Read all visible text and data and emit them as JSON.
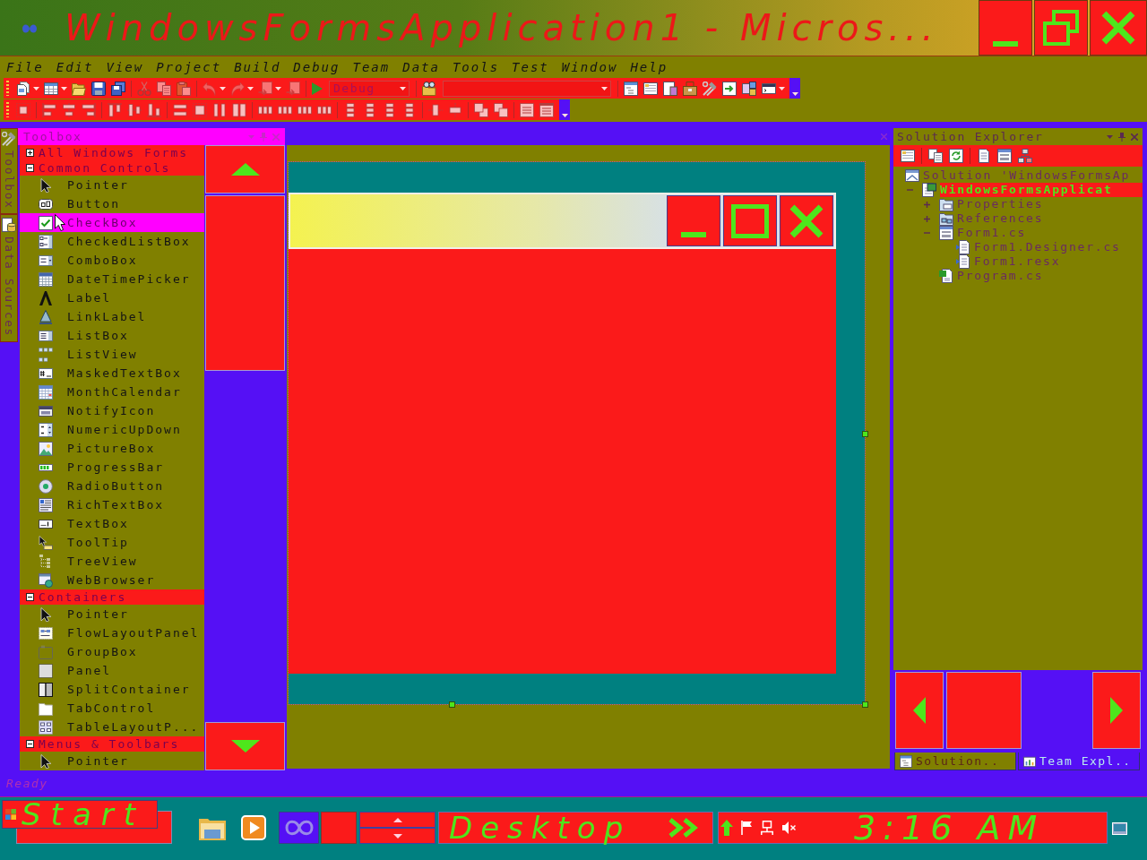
{
  "window": {
    "title": "WindowsFormsApplication1 - Micros..."
  },
  "menu": [
    "File",
    "Edit",
    "View",
    "Project",
    "Build",
    "Debug",
    "Team",
    "Data",
    "Tools",
    "Test",
    "Window",
    "Help"
  ],
  "standard_toolbar": {
    "configuration": "Debug"
  },
  "side_tabs": [
    {
      "label": "Toolbox",
      "kind": "toolbox"
    },
    {
      "label": "Data Sources",
      "kind": "data"
    }
  ],
  "toolbox": {
    "title": "Toolbox",
    "groups": [
      {
        "label": "All Windows Forms",
        "expanded": false
      },
      {
        "label": "Common Controls",
        "expanded": true,
        "items": [
          {
            "label": "Pointer",
            "kind": "pointer",
            "selected": false
          },
          {
            "label": "Button",
            "kind": "button",
            "selected": false
          },
          {
            "label": "CheckBox",
            "kind": "checkbox",
            "selected": true
          },
          {
            "label": "CheckedListBox",
            "kind": "checkedlist",
            "selected": false
          },
          {
            "label": "ComboBox",
            "kind": "combo",
            "selected": false
          },
          {
            "label": "DateTimePicker",
            "kind": "datetime",
            "selected": false
          },
          {
            "label": "Label",
            "kind": "label",
            "selected": false
          },
          {
            "label": "LinkLabel",
            "kind": "linklabel",
            "selected": false
          },
          {
            "label": "ListBox",
            "kind": "listbox",
            "selected": false
          },
          {
            "label": "ListView",
            "kind": "listview",
            "selected": false
          },
          {
            "label": "MaskedTextBox",
            "kind": "masked",
            "selected": false
          },
          {
            "label": "MonthCalendar",
            "kind": "monthcal",
            "selected": false
          },
          {
            "label": "NotifyIcon",
            "kind": "notify",
            "selected": false
          },
          {
            "label": "NumericUpDown",
            "kind": "numeric",
            "selected": false
          },
          {
            "label": "PictureBox",
            "kind": "picture",
            "selected": false
          },
          {
            "label": "ProgressBar",
            "kind": "progress",
            "selected": false
          },
          {
            "label": "RadioButton",
            "kind": "radio",
            "selected": false
          },
          {
            "label": "RichTextBox",
            "kind": "richtext",
            "selected": false
          },
          {
            "label": "TextBox",
            "kind": "textbox",
            "selected": false
          },
          {
            "label": "ToolTip",
            "kind": "tooltip",
            "selected": false
          },
          {
            "label": "TreeView",
            "kind": "treeview",
            "selected": false
          },
          {
            "label": "WebBrowser",
            "kind": "web",
            "selected": false
          }
        ]
      },
      {
        "label": "Containers",
        "expanded": true,
        "items": [
          {
            "label": "Pointer",
            "kind": "pointer",
            "selected": false
          },
          {
            "label": "FlowLayoutPanel",
            "kind": "flowlayout",
            "selected": false
          },
          {
            "label": "GroupBox",
            "kind": "groupbox",
            "selected": false
          },
          {
            "label": "Panel",
            "kind": "panel",
            "selected": false
          },
          {
            "label": "SplitContainer",
            "kind": "split",
            "selected": false
          },
          {
            "label": "TabControl",
            "kind": "tabcontrol",
            "selected": false
          },
          {
            "label": "TableLayoutP...",
            "kind": "tablelayout",
            "selected": false
          }
        ]
      },
      {
        "label": "Menus & Toolbars",
        "expanded": true,
        "items": [
          {
            "label": "Pointer",
            "kind": "pointer",
            "selected": false
          }
        ]
      }
    ]
  },
  "solution_explorer": {
    "title": "Solution Explorer",
    "tree": [
      {
        "label": "Solution 'WindowsFormsAp",
        "kind": "solution",
        "selected": false,
        "children": [
          {
            "label": "WindowsFormsApplicat",
            "kind": "project",
            "selected": true,
            "expanded": true,
            "children": [
              {
                "label": "Properties",
                "kind": "properties",
                "selected": false,
                "expanded": false
              },
              {
                "label": "References",
                "kind": "references",
                "selected": false,
                "expanded": false
              },
              {
                "label": "Form1.cs",
                "kind": "form",
                "selected": false,
                "expanded": true,
                "children": [
                  {
                    "label": "Form1.Designer.cs",
                    "kind": "code",
                    "selected": false
                  },
                  {
                    "label": "Form1.resx",
                    "kind": "code",
                    "selected": false
                  }
                ]
              },
              {
                "label": "Program.cs",
                "kind": "csharp",
                "selected": false
              }
            ]
          }
        ]
      }
    ],
    "tabs": [
      {
        "label": "Solution..",
        "kind": "solution",
        "selected": true
      },
      {
        "label": "Team Expl..",
        "kind": "team",
        "selected": false
      }
    ]
  },
  "status_bar": {
    "text": "Ready"
  },
  "taskbar": {
    "start": "Start",
    "apps": [
      {
        "kind": "folder",
        "selected": false
      },
      {
        "kind": "media",
        "selected": false
      },
      {
        "kind": "studio",
        "selected": true
      }
    ],
    "desktop_toolbar": "Desktop",
    "clock": "3:16 AM"
  }
}
